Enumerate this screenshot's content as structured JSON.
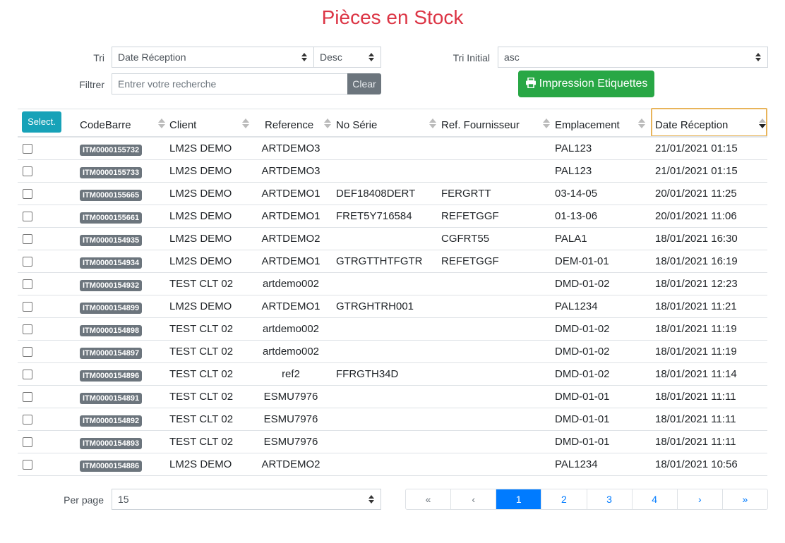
{
  "title": "Pièces en Stock",
  "controls": {
    "tri_label": "Tri",
    "tri_value": "Date Réception",
    "order_value": "Desc",
    "tri_initial_label": "Tri Initial",
    "tri_initial_value": "asc",
    "filtrer_label": "Filtrer",
    "search_placeholder": "Entrer votre recherche",
    "clear_label": "Clear",
    "print_label": "Impression Etiquettes",
    "select_label": "Select."
  },
  "table": {
    "headers": [
      "CodeBarre",
      "Client",
      "Reference",
      "No Série",
      "Ref. Fournisseur",
      "Emplacement",
      "Date Réception"
    ],
    "rows": [
      {
        "code": "ITM0000155732",
        "client": "LM2S DEMO",
        "ref": "ARTDEMO3",
        "serie": "",
        "fournisseur": "",
        "emplacement": "PAL123",
        "date": "21/01/2021 01:15"
      },
      {
        "code": "ITM0000155733",
        "client": "LM2S DEMO",
        "ref": "ARTDEMO3",
        "serie": "",
        "fournisseur": "",
        "emplacement": "PAL123",
        "date": "21/01/2021 01:15"
      },
      {
        "code": "ITM0000155665",
        "client": "LM2S DEMO",
        "ref": "ARTDEMO1",
        "serie": "DEF18408DERT",
        "fournisseur": "FERGRTT",
        "emplacement": "03-14-05",
        "date": "20/01/2021 11:25"
      },
      {
        "code": "ITM0000155661",
        "client": "LM2S DEMO",
        "ref": "ARTDEMO1",
        "serie": "FRET5Y716584",
        "fournisseur": "REFETGGF",
        "emplacement": "01-13-06",
        "date": "20/01/2021 11:06"
      },
      {
        "code": "ITM0000154935",
        "client": "LM2S DEMO",
        "ref": "ARTDEMO2",
        "serie": "",
        "fournisseur": "CGFRT55",
        "emplacement": "PALA1",
        "date": "18/01/2021 16:30"
      },
      {
        "code": "ITM0000154934",
        "client": "LM2S DEMO",
        "ref": "ARTDEMO1",
        "serie": "GTRGTTHTFGTR",
        "fournisseur": "REFETGGF",
        "emplacement": "DEM-01-01",
        "date": "18/01/2021 16:19"
      },
      {
        "code": "ITM0000154932",
        "client": "TEST CLT 02",
        "ref": "artdemo002",
        "serie": "",
        "fournisseur": "",
        "emplacement": "DMD-01-02",
        "date": "18/01/2021 12:23"
      },
      {
        "code": "ITM0000154899",
        "client": "LM2S DEMO",
        "ref": "ARTDEMO1",
        "serie": "GTRGHTRH001",
        "fournisseur": "",
        "emplacement": "PAL1234",
        "date": "18/01/2021 11:21"
      },
      {
        "code": "ITM0000154898",
        "client": "TEST CLT 02",
        "ref": "artdemo002",
        "serie": "",
        "fournisseur": "",
        "emplacement": "DMD-01-02",
        "date": "18/01/2021 11:19"
      },
      {
        "code": "ITM0000154897",
        "client": "TEST CLT 02",
        "ref": "artdemo002",
        "serie": "",
        "fournisseur": "",
        "emplacement": "DMD-01-02",
        "date": "18/01/2021 11:19"
      },
      {
        "code": "ITM0000154896",
        "client": "TEST CLT 02",
        "ref": "ref2",
        "serie": "FFRGTH34D",
        "fournisseur": "",
        "emplacement": "DMD-01-02",
        "date": "18/01/2021 11:14"
      },
      {
        "code": "ITM0000154891",
        "client": "TEST CLT 02",
        "ref": "ESMU7976",
        "serie": "",
        "fournisseur": "",
        "emplacement": "DMD-01-01",
        "date": "18/01/2021 11:11"
      },
      {
        "code": "ITM0000154892",
        "client": "TEST CLT 02",
        "ref": "ESMU7976",
        "serie": "",
        "fournisseur": "",
        "emplacement": "DMD-01-01",
        "date": "18/01/2021 11:11"
      },
      {
        "code": "ITM0000154893",
        "client": "TEST CLT 02",
        "ref": "ESMU7976",
        "serie": "",
        "fournisseur": "",
        "emplacement": "DMD-01-01",
        "date": "18/01/2021 11:11"
      },
      {
        "code": "ITM0000154886",
        "client": "LM2S DEMO",
        "ref": "ARTDEMO2",
        "serie": "",
        "fournisseur": "",
        "emplacement": "PAL1234",
        "date": "18/01/2021 10:56"
      }
    ]
  },
  "footer": {
    "per_page_label": "Per page",
    "per_page_value": "15",
    "pagination": [
      "«",
      "‹",
      "1",
      "2",
      "3",
      "4",
      "›",
      "»"
    ]
  },
  "colors": {
    "title": "#dc3545",
    "print_button": "#28a745",
    "select_button": "#17a2b8",
    "active_page": "#007bff"
  }
}
